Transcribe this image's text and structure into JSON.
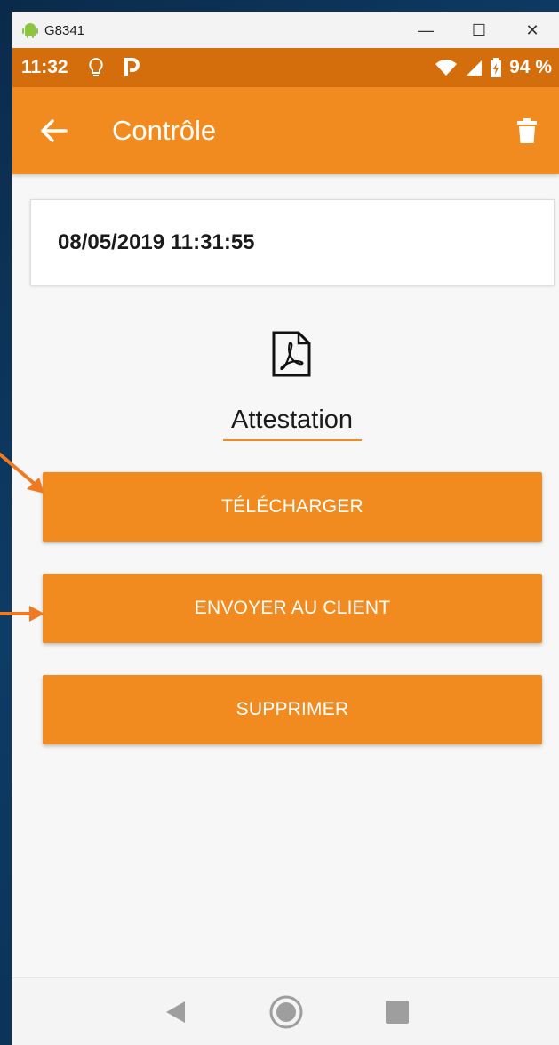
{
  "window": {
    "title": "G8341",
    "minimize_glyph": "—",
    "maximize_glyph": "☐",
    "close_glyph": "✕",
    "icon": "android-icon"
  },
  "status_bar": {
    "time": "11:32",
    "battery": "94 %",
    "icons": [
      "lightbulb-icon",
      "parking-icon",
      "wifi-icon",
      "signal-icon",
      "battery-icon"
    ]
  },
  "app_bar": {
    "title": "Contrôle",
    "back_icon": "back-arrow-icon",
    "delete_icon": "trash-icon"
  },
  "card": {
    "datetime": "08/05/2019 11:31:55"
  },
  "attachment": {
    "label": "Attestation",
    "icon": "pdf-file-icon"
  },
  "buttons": {
    "download": "TÉLÉCHARGER",
    "send": "ENVOYER AU CLIENT",
    "delete": "SUPPRIMER"
  },
  "nav_bar": {
    "icons": [
      "back-triangle-icon",
      "home-circle-icon",
      "recents-square-icon"
    ]
  },
  "colors": {
    "accent": "#f28b1f",
    "status_bar": "#d46e0d",
    "arrow": "#f07a22"
  }
}
